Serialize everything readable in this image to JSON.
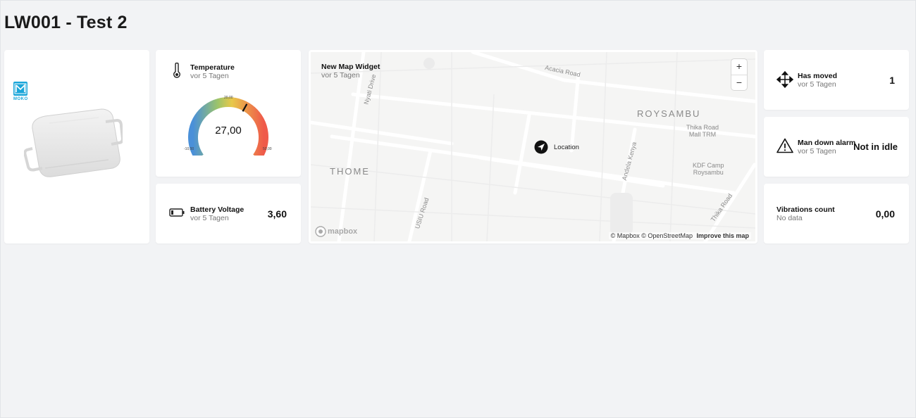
{
  "page": {
    "title": "LW001 - Test 2"
  },
  "device": {
    "logo_text": "MOKO",
    "image_icon": "device-enclosure-icon"
  },
  "temperature": {
    "title": "Temperature",
    "subtitle": "vor 5 Tagen",
    "icon": "thermometer-icon",
    "value_text": "27,00",
    "min_label": "-10,00",
    "mid_label": "20,00",
    "max_label": "50,00",
    "value": 27,
    "min": -10,
    "max": 50
  },
  "battery": {
    "title": "Battery Voltage",
    "subtitle": "vor 5 Tagen",
    "icon": "battery-icon",
    "value_text": "3,60"
  },
  "map": {
    "title": "New Map Widget",
    "subtitle": "vor 5 Tagen",
    "marker_label": "Location",
    "zoom_in": "+",
    "zoom_out": "−",
    "attribution_mapbox": "© Mapbox",
    "attribution_osm": "© OpenStreetMap",
    "improve": "Improve this map",
    "logo": "mapbox",
    "places": {
      "roysambu": "ROYSAMBU",
      "thome": "THOME",
      "acacia": "Acacia Road",
      "nyati": "Nyati Drive",
      "thika_mall": "Thika Road",
      "thika_mall2": "Mall TRM",
      "kdf1": "KDF Camp",
      "kdf2": "Roysambu",
      "usiu": "USIU Road",
      "andela": "Andela Kenya",
      "thika_road": "Thika Road"
    }
  },
  "has_moved": {
    "title": "Has moved",
    "subtitle": "vor 5 Tagen",
    "icon": "move-arrows-icon",
    "value_text": "1"
  },
  "man_down": {
    "title": "Man down alarm",
    "subtitle": "vor 5 Tagen",
    "icon": "warning-triangle-icon",
    "value_text": "Not in idle"
  },
  "vibrations": {
    "title": "Vibrations count",
    "subtitle": "No data",
    "value_text": "0,00"
  },
  "colors": {
    "background": "#f2f3f5",
    "card": "#ffffff",
    "moko_blue": "#1aa6d9",
    "gauge_cold": "#4a90d9",
    "gauge_mid": "#e8c84a",
    "gauge_hot": "#ef5a4a"
  }
}
